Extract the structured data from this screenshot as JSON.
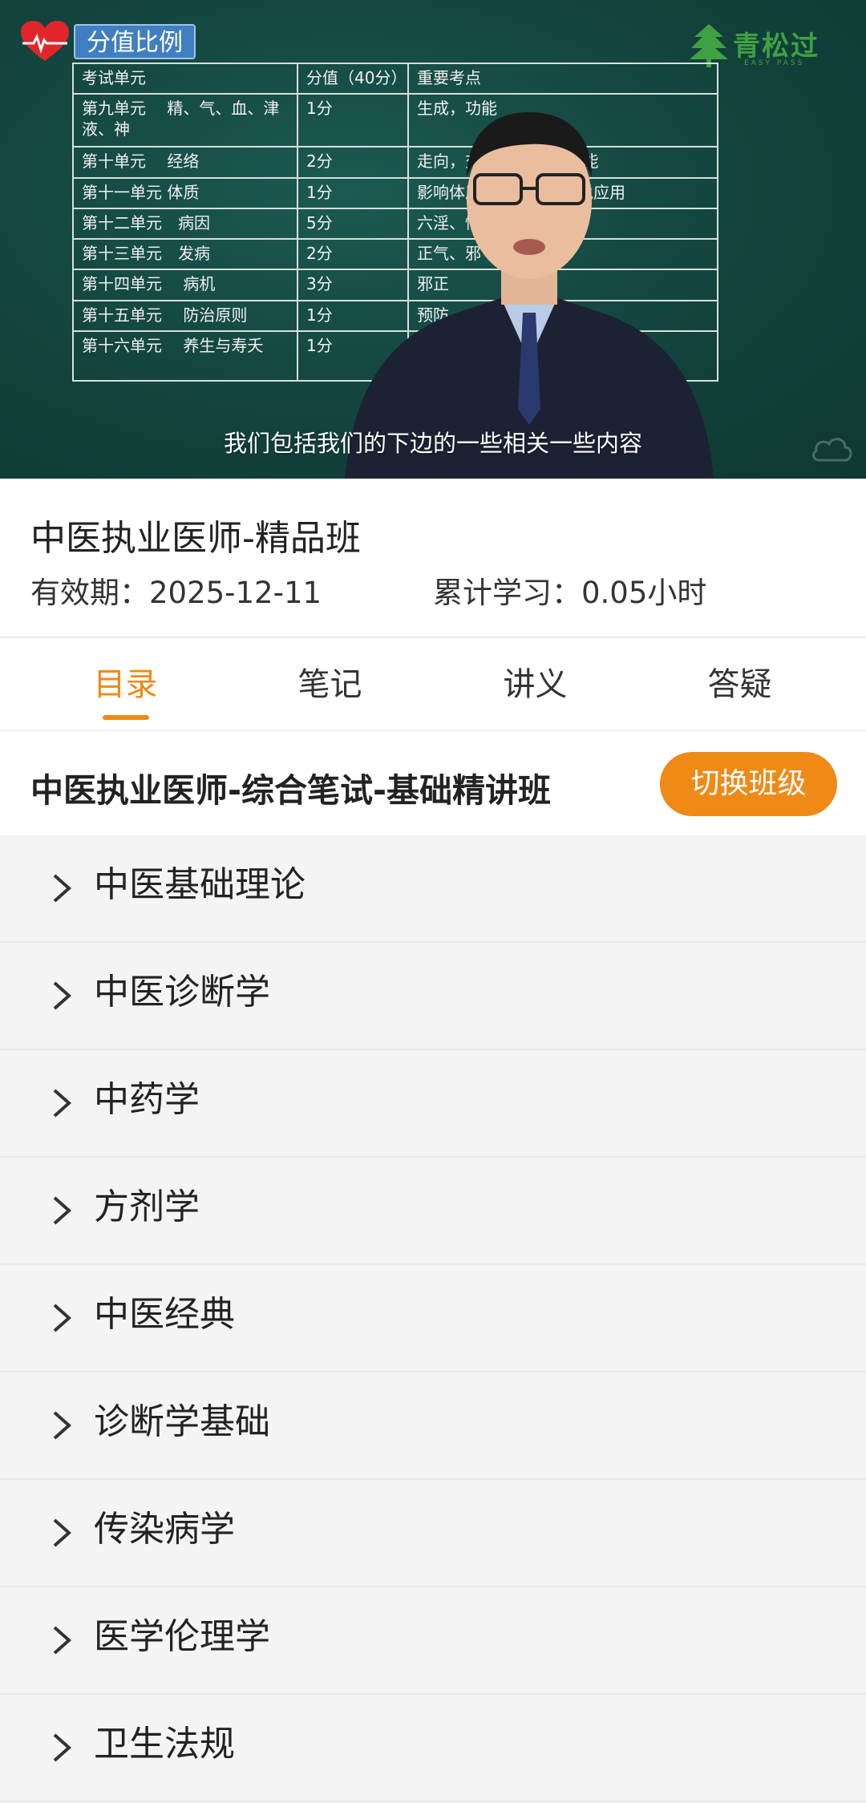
{
  "video": {
    "tag": "分值比例",
    "brand_name": "青松过",
    "brand_sub": "EASY PASS",
    "subtitle": "我们包括我们的下边的一些相关一些内容",
    "table": {
      "headers": [
        "考试单元",
        "分值（40分）",
        "重要考点"
      ],
      "rows": [
        [
          "第九单元　 精、气、血、津液、神",
          "1分",
          "生成，功能"
        ],
        [
          "第十单元　 经络",
          "2分",
          "走向，交接　　　　 功能"
        ],
        [
          "第十一单元 体质",
          "1分",
          "影响体质的　　　　学说应用"
        ],
        [
          "第十二单元　病因",
          "5分",
          "六淫、情志、"
        ],
        [
          "第十三单元　发病",
          "2分",
          "正气、邪"
        ],
        [
          "第十四单元　 病机",
          "3分",
          "邪正"
        ],
        [
          "第十五单元　 防治原则",
          "1分",
          "预防"
        ],
        [
          "第十六单元　 养生与寿夭",
          "1分",
          ""
        ]
      ]
    }
  },
  "course": {
    "title": "中医执业医师-精品班",
    "valid": "有效期：2025-12-11",
    "study": "累计学习：0.05小时"
  },
  "tabs": [
    {
      "label": "目录",
      "active": true
    },
    {
      "label": "笔记",
      "active": false
    },
    {
      "label": "讲义",
      "active": false
    },
    {
      "label": "答疑",
      "active": false
    }
  ],
  "class_header": {
    "name": "中医执业医师-综合笔试-基础精讲班",
    "switch_label": "切换班级"
  },
  "chapters": [
    {
      "label": "中医基础理论"
    },
    {
      "label": "中医诊断学"
    },
    {
      "label": "中药学"
    },
    {
      "label": "方剂学"
    },
    {
      "label": "中医经典"
    },
    {
      "label": "诊断学基础"
    },
    {
      "label": "传染病学"
    },
    {
      "label": "医学伦理学"
    },
    {
      "label": "卫生法规"
    }
  ],
  "colors": {
    "accent": "#ef8a16",
    "board": "#13453f",
    "brand_green": "#3fa142",
    "tag_blue": "#3f7fc1"
  },
  "icons": {
    "heart": "heart-ecg-icon",
    "brand": "pine-tree-logo-icon",
    "chevron": "chevron-right-icon",
    "watermark": "cloud-watermark-icon"
  }
}
